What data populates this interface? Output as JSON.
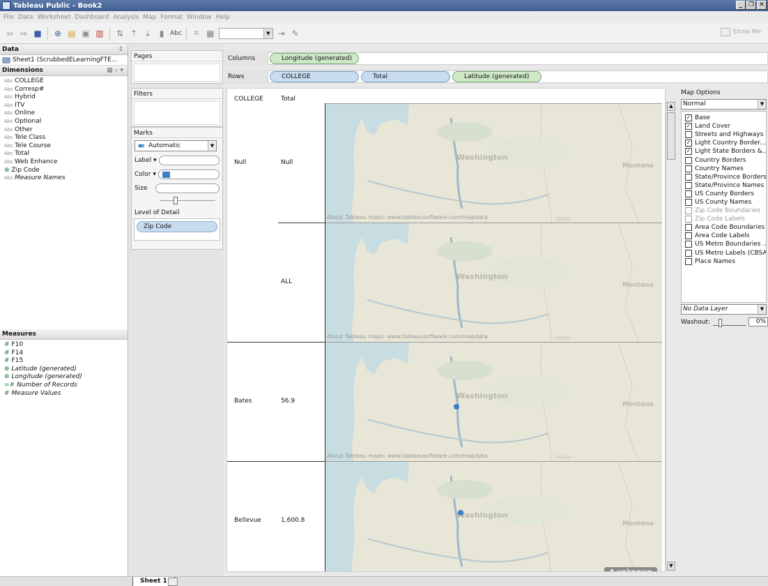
{
  "window": {
    "title": "Tableau Public - Book2",
    "controls": [
      "_",
      "❐",
      "✕"
    ]
  },
  "menu": [
    "File",
    "Data",
    "Worksheet",
    "Dashboard",
    "Analysis",
    "Map",
    "Format",
    "Window",
    "Help"
  ],
  "toolbar": {
    "abc_label": "Abc",
    "show_me_label": "Show Me"
  },
  "data_pane": {
    "header": "Data",
    "datasource": "Sheet1 (ScrubbedELearningFTE...",
    "dimensions_header": "Dimensions",
    "dimensions": [
      {
        "type": "Abc",
        "name": "COLLEGE",
        "italic": false
      },
      {
        "type": "Abc",
        "name": "Corresp#",
        "italic": false
      },
      {
        "type": "Abc",
        "name": "Hybrid",
        "italic": false
      },
      {
        "type": "Abc",
        "name": "ITV",
        "italic": false
      },
      {
        "type": "Abc",
        "name": "Online",
        "italic": false
      },
      {
        "type": "Abc",
        "name": "Optional",
        "italic": false
      },
      {
        "type": "Abc",
        "name": "Other",
        "italic": false
      },
      {
        "type": "Abc",
        "name": "Tele Class",
        "italic": false
      },
      {
        "type": "Abc",
        "name": "Tele Course",
        "italic": false
      },
      {
        "type": "Abc",
        "name": "Total",
        "italic": false
      },
      {
        "type": "Abc",
        "name": "Web Enhance",
        "italic": false
      },
      {
        "type": "globe",
        "name": "Zip Code",
        "italic": false
      },
      {
        "type": "Abc",
        "name": "Measure Names",
        "italic": true
      }
    ],
    "measures_header": "Measures",
    "measures": [
      {
        "type": "#",
        "name": "F10",
        "italic": false
      },
      {
        "type": "#",
        "name": "F14",
        "italic": false
      },
      {
        "type": "#",
        "name": "F15",
        "italic": false
      },
      {
        "type": "globe",
        "name": "Latitude (generated)",
        "italic": true
      },
      {
        "type": "globe",
        "name": "Longitude (generated)",
        "italic": true
      },
      {
        "type": "=#",
        "name": "Number of Records",
        "italic": true
      },
      {
        "type": "#",
        "name": "Measure Values",
        "italic": true
      }
    ]
  },
  "cards": {
    "pages": "Pages",
    "filters": "Filters",
    "marks": "Marks",
    "mark_type": "Automatic",
    "label": "Label",
    "color": "Color",
    "size": "Size",
    "level_of_detail": "Level of Detail",
    "lod_field": "Zip Code"
  },
  "shelves": {
    "columns_label": "Columns",
    "rows_label": "Rows",
    "columns": [
      "Longitude (generated)"
    ],
    "rows": [
      "COLLEGE",
      "Total",
      "Latitude (generated)"
    ]
  },
  "view": {
    "headers": [
      "COLLEGE",
      "Total"
    ],
    "rows": [
      {
        "college": "Null",
        "total": "Null",
        "dot": null,
        "credit": "About Tableau maps: www.tableausoftware.com/mapdata"
      },
      {
        "college": "",
        "total": "ALL",
        "dot": null,
        "credit": "About Tableau maps: www.tableausoftware.com/mapdata"
      },
      {
        "college": "Bates",
        "total": "56.9",
        "dot": "Tacoma",
        "credit": "About Tableau maps: www.tableausoftware.com/mapdata"
      },
      {
        "college": "Bellevue",
        "total": "1,600.8",
        "dot": "Bellevue",
        "credit": ""
      }
    ],
    "map_labels": {
      "state1": "Washington",
      "state2": "Montana",
      "state3": "Idaho"
    },
    "unknown_badge": "4 unknown"
  },
  "map_options": {
    "title": "Map Options",
    "style": "Normal",
    "layers": [
      {
        "label": "Base",
        "checked": true,
        "enabled": true
      },
      {
        "label": "Land Cover",
        "checked": true,
        "enabled": true
      },
      {
        "label": "Streets and Highways",
        "checked": false,
        "enabled": true
      },
      {
        "label": "Light Country Border...",
        "checked": true,
        "enabled": true
      },
      {
        "label": "Light State Borders &...",
        "checked": true,
        "enabled": true
      },
      {
        "label": "Country Borders",
        "checked": false,
        "enabled": true
      },
      {
        "label": "Country Names",
        "checked": false,
        "enabled": true
      },
      {
        "label": "State/Province Borders",
        "checked": false,
        "enabled": true
      },
      {
        "label": "State/Province Names",
        "checked": false,
        "enabled": true
      },
      {
        "label": "US County Borders",
        "checked": false,
        "enabled": true
      },
      {
        "label": "US County Names",
        "checked": false,
        "enabled": true
      },
      {
        "label": "Zip Code Boundaries",
        "checked": false,
        "enabled": false
      },
      {
        "label": "Zip Code Labels",
        "checked": false,
        "enabled": false
      },
      {
        "label": "Area Code Boundaries",
        "checked": false,
        "enabled": true
      },
      {
        "label": "Area Code Labels",
        "checked": false,
        "enabled": true
      },
      {
        "label": "US Metro Boundaries ...",
        "checked": false,
        "enabled": true
      },
      {
        "label": "US Metro Labels (CBSA)",
        "checked": false,
        "enabled": true
      },
      {
        "label": "Place Names",
        "checked": false,
        "enabled": true
      }
    ],
    "data_layer": "No Data Layer",
    "washout_label": "Washout:",
    "washout_value": "0%"
  },
  "sheet_tabs": [
    "Sheet 1"
  ],
  "colors": {
    "mark": "#3b7fc4",
    "water": "#c8dde2",
    "land": "#e8e6d7",
    "pill_blue": "#c8dcf0",
    "pill_green": "#cfe9c8"
  }
}
